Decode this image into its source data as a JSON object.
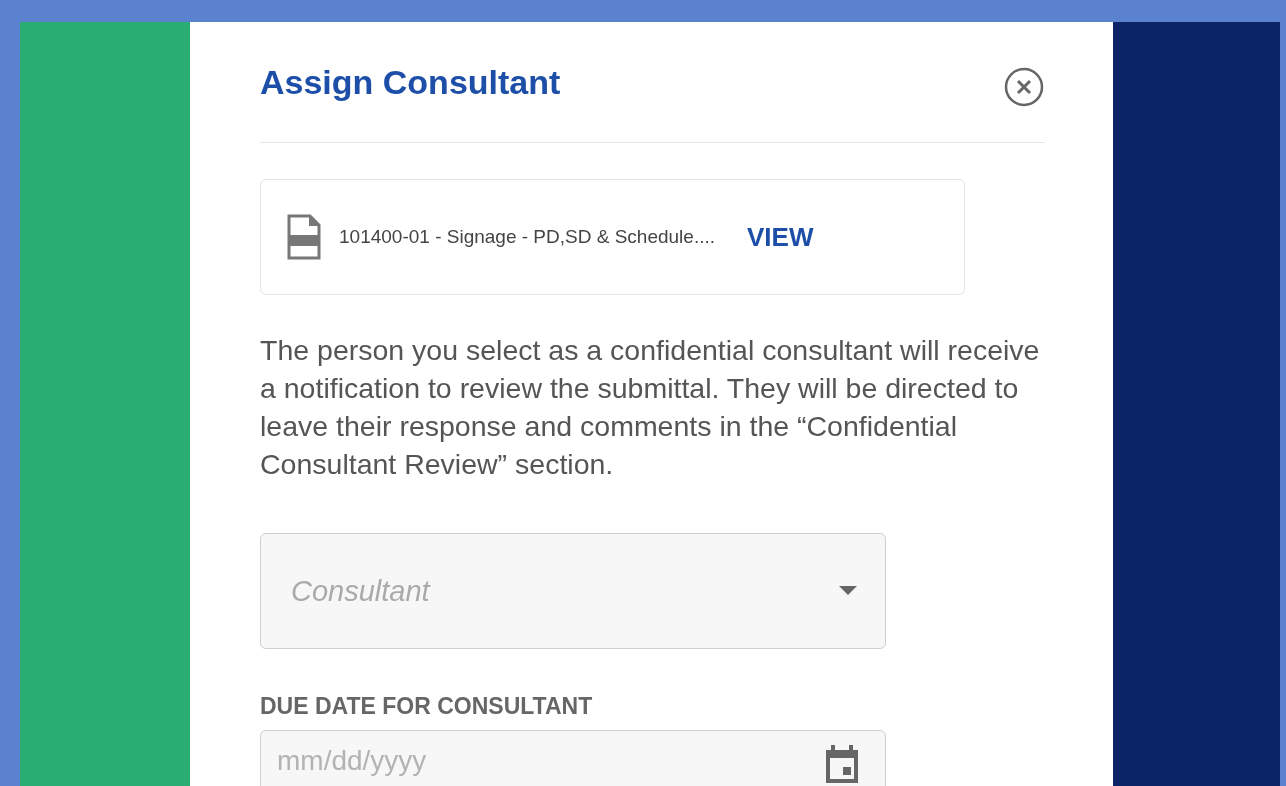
{
  "dialog": {
    "title": "Assign Consultant",
    "attachment": {
      "file_name": "101400-01 - Signage - PD,SD & Schedule....",
      "action": "VIEW"
    },
    "description": "The person you select as a confidential consultant will receive a notification to review the submittal. They will be directed to leave their response and comments in the “Confidential Consultant Review” section.",
    "consultant_select": {
      "placeholder": "Consultant"
    },
    "due_date": {
      "label": "DUE DATE FOR CONSULTANT",
      "placeholder": "mm/dd/yyyy"
    }
  }
}
